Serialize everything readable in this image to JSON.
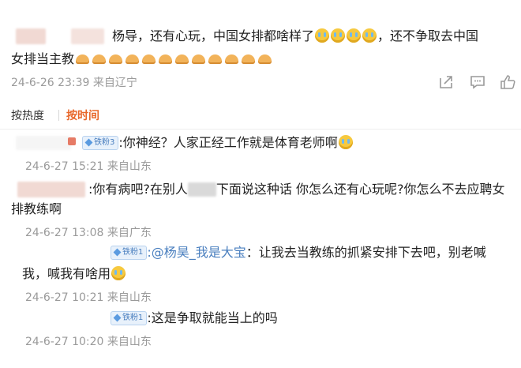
{
  "main_comment": {
    "text_line1": "杨导，还有心玩，中国女排都啥样了",
    "text_line1_tail": "，还不争取去中国",
    "text_line2": "女排当主教",
    "crying_emoji_count": 4,
    "hands_emoji_count": 12,
    "date": "24-6-26 23:39",
    "location": "来自辽宁"
  },
  "actions": {
    "share_icon": "share-icon",
    "comment_icon": "comment-icon",
    "like_icon": "like-icon"
  },
  "sort_tabs": {
    "hot": "按热度",
    "time": "按时间"
  },
  "badge_label": "铁粉",
  "replies": [
    {
      "badge_level": "3",
      "text": ":你神经？人家正经工作就是体育老师啊",
      "date": "24-6-27 15:21",
      "location": "来自山东"
    },
    {
      "text_a": ":你有病吧?在别人",
      "text_b": "下面说这种话  你怎么还有心玩呢?你怎么不去应聘女",
      "text_line2": "排教练啊",
      "date": "24-6-27 13:08",
      "location": "来自广东"
    },
    {
      "badge_level": "1",
      "mention": ":@杨昊_我是大宝",
      "text": "：让我去当教练的抓紧安排下去吧，别老喊",
      "text_line2": "我，喊我有啥用",
      "date": "24-6-27 10:21",
      "location": "来自山东"
    },
    {
      "badge_level": "1",
      "text": ":这是争取就能当上的吗",
      "date": "24-6-27 10:20",
      "location": "来自山东"
    }
  ]
}
